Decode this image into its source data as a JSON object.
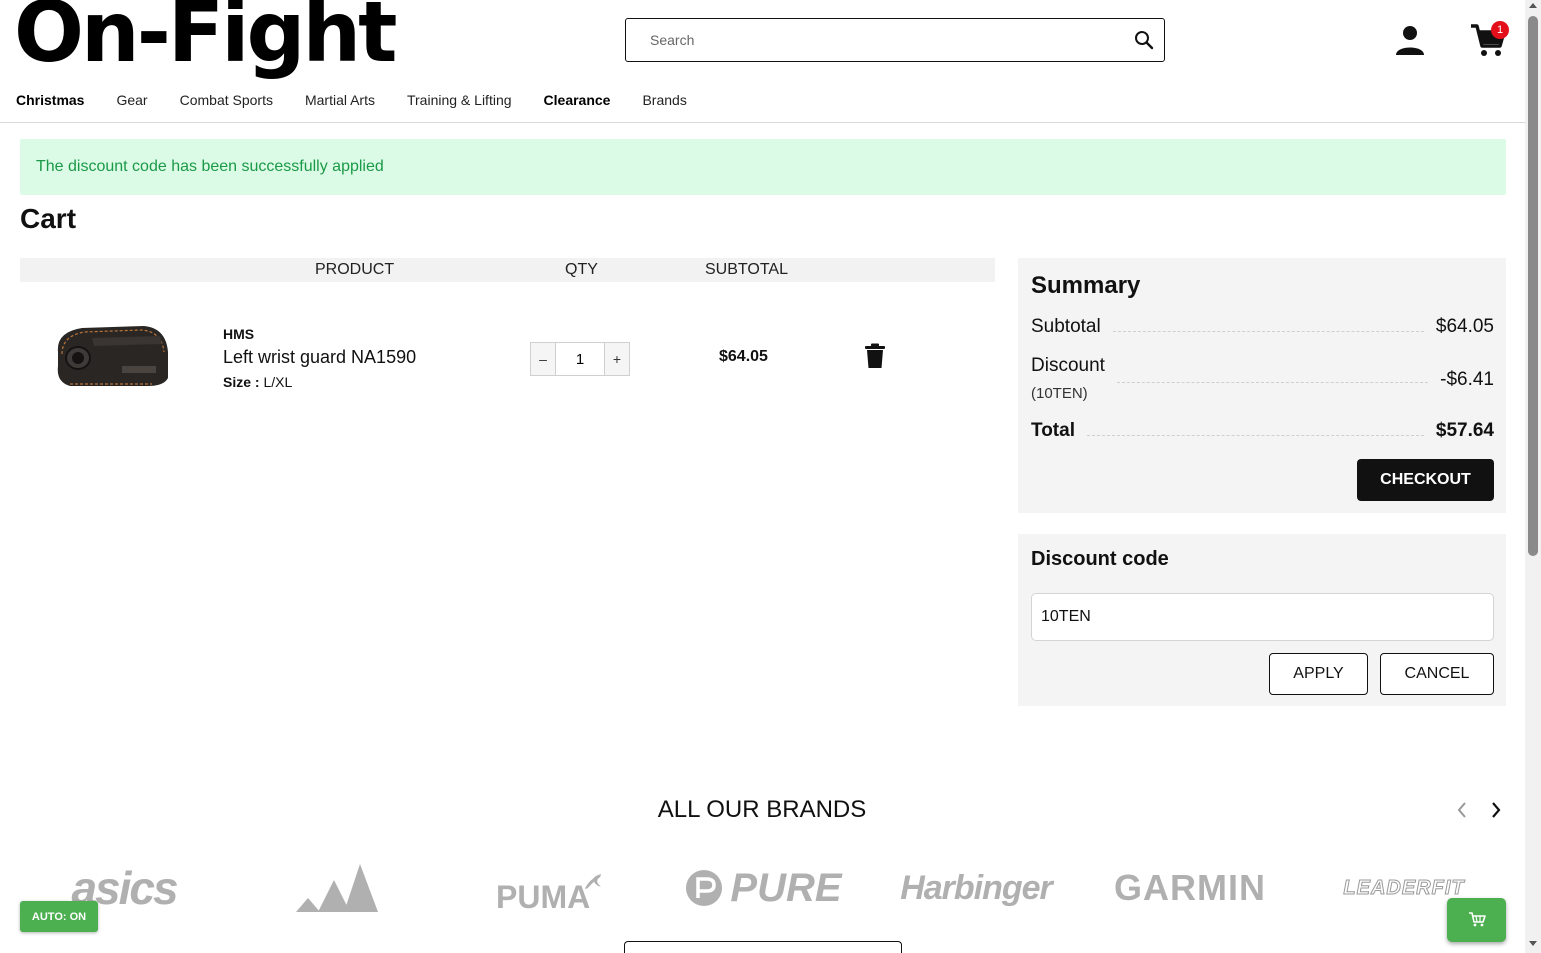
{
  "header": {
    "logo": "On-Fight",
    "search_placeholder": "Search",
    "cart_count": "1"
  },
  "nav": {
    "items": [
      {
        "label": "Christmas",
        "bold": true
      },
      {
        "label": "Gear",
        "bold": false
      },
      {
        "label": "Combat Sports",
        "bold": false
      },
      {
        "label": "Martial Arts",
        "bold": false
      },
      {
        "label": "Training & Lifting",
        "bold": false
      },
      {
        "label": "Clearance",
        "bold": true
      },
      {
        "label": "Brands",
        "bold": false
      }
    ]
  },
  "alert": {
    "message": "The discount code has been successfully applied",
    "color": "#1a9a47"
  },
  "cart": {
    "title": "Cart",
    "columns": {
      "product": "PRODUCT",
      "qty": "QTY",
      "subtotal": "SUBTOTAL"
    },
    "items": [
      {
        "brand": "HMS",
        "name": "Left wrist guard NA1590",
        "size_label": "Size :",
        "size_value": "L/XL",
        "qty_minus": "–",
        "qty": "1",
        "qty_plus": "+",
        "subtotal": "$64.05"
      }
    ]
  },
  "summary": {
    "title": "Summary",
    "subtotal_label": "Subtotal",
    "subtotal_value": "$64.05",
    "discount_label": "Discount",
    "discount_code": "(10TEN)",
    "discount_value": "-$6.41",
    "total_label": "Total",
    "total_value": "$57.64",
    "checkout_label": "CHECKOUT"
  },
  "discount_box": {
    "title": "Discount code",
    "input_value": "10TEN",
    "apply_label": "APPLY",
    "cancel_label": "CANCEL"
  },
  "brands": {
    "title": "ALL OUR BRANDS",
    "logos": {
      "asics": "asics",
      "puma": "PUMA",
      "pure": "PURE",
      "harbinger": "Harbinger",
      "garmin": "GARMIN",
      "leaderfit": "LEADERFIT"
    }
  },
  "floating": {
    "auto_label": "AUTO: ON",
    "accent": "#4caf50"
  }
}
